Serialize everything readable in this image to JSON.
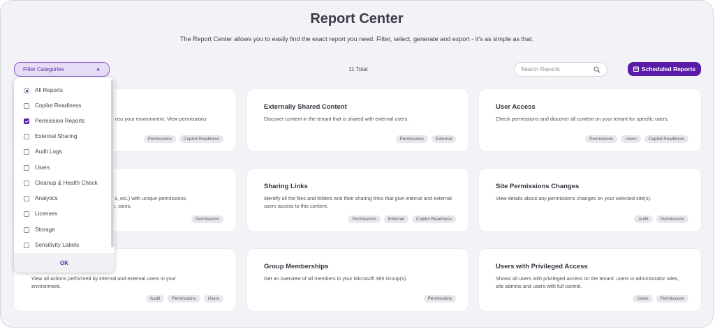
{
  "header": {
    "title": "Report Center",
    "subtitle": "The Report Center allows you to easily find the exact report you need. Filter, select, generate and export - it's as simple as that."
  },
  "toolbar": {
    "filter_label": "Filter Categories",
    "total_label": "11 Total",
    "search_placeholder": "Search Reports",
    "scheduled_label": "Scheduled Reports"
  },
  "filter_dropdown": {
    "options": [
      {
        "label": "All Reports",
        "type": "radio",
        "checked": true
      },
      {
        "label": "Copilot Readiness",
        "type": "checkbox",
        "checked": false
      },
      {
        "label": "Permission Reports",
        "type": "checkbox",
        "checked": true
      },
      {
        "label": "External Sharing",
        "type": "checkbox",
        "checked": false
      },
      {
        "label": "Audit Logs",
        "type": "checkbox",
        "checked": false
      },
      {
        "label": "Users",
        "type": "checkbox",
        "checked": false
      },
      {
        "label": "Cleanup & Health Check",
        "type": "checkbox",
        "checked": false
      },
      {
        "label": "Analytics",
        "type": "checkbox",
        "checked": false
      },
      {
        "label": "Licenses",
        "type": "checkbox",
        "checked": false
      },
      {
        "label": "Storage",
        "type": "checkbox",
        "checked": false
      },
      {
        "label": "Sensitivity Labels",
        "type": "checkbox",
        "checked": false
      }
    ],
    "ok_label": "OK"
  },
  "cards": [
    {
      "title": "",
      "description": "across your environment. View permissions",
      "tags": [
        "Permissions",
        "Copilot Readiness"
      ]
    },
    {
      "title": "Externally Shared Content",
      "description": "Discover content in the tenant that is shared with external users.",
      "tags": [
        "Permissions",
        "External"
      ]
    },
    {
      "title": "User Access",
      "description": "Check permissions and discover all content on your tenant for specific users.",
      "tags": [
        "Permissions",
        "Users",
        "Copilot Readiness"
      ]
    },
    {
      "title": "",
      "description": "files, etc.) with unique permissions, e.g. sions.",
      "tags": [
        "Permissions"
      ]
    },
    {
      "title": "Sharing Links",
      "description": "Identify all the files and folders and their sharing links that give internal and external users access to this content.",
      "tags": [
        "Permissions",
        "External",
        "Copilot Readiness"
      ]
    },
    {
      "title": "Site Permissions Changes",
      "description": "View details about any permissions changes on your selected site(s).",
      "tags": [
        "Audit",
        "Permissions"
      ]
    },
    {
      "title": "",
      "description": "View all actions performed by internal and external users in your environment.",
      "tags": [
        "Audit",
        "Permissions",
        "Users"
      ]
    },
    {
      "title": "Group Memberships",
      "description": "Get an overview of all members in your Microsoft 365 Group(s).",
      "tags": [
        "Permissions"
      ]
    },
    {
      "title": "Users with Privileged Access",
      "description": "Shows all users with privileged access on the tenant: users in administrator roles, site admins and users with full control.",
      "tags": [
        "Users",
        "Permissions"
      ]
    }
  ]
}
